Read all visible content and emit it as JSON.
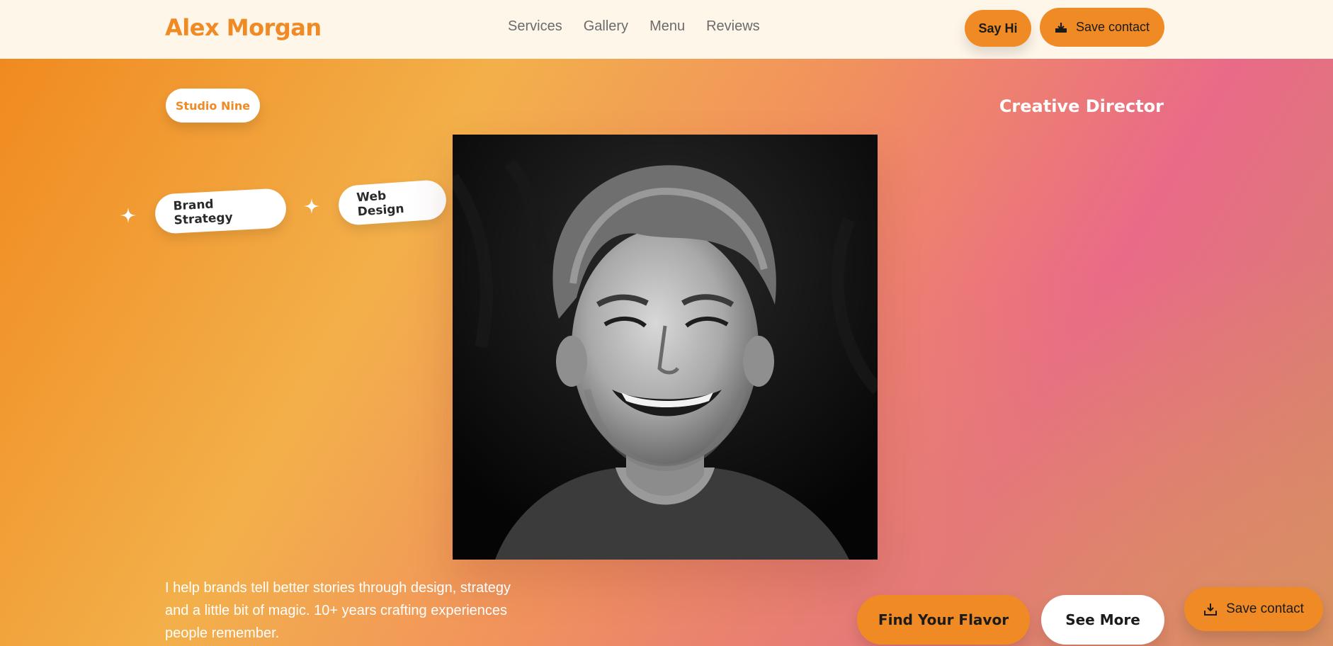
{
  "header": {
    "logo": "Alex Morgan",
    "nav": [
      {
        "label": "Services"
      },
      {
        "label": "Gallery"
      },
      {
        "label": "Menu"
      },
      {
        "label": "Reviews"
      }
    ],
    "say_hi": "Say Hi",
    "save_contact": "Save contact",
    "save_icon": "download-tray-icon"
  },
  "hero": {
    "badge": "Studio Nine",
    "role": "Creative Director",
    "chips": [
      "Brand Strategy",
      "Web Design"
    ],
    "sparkle_icon": "sparkle-icon",
    "photo_icon": "portrait-photo",
    "intro": "I help brands tell better stories through design, strategy and a little bit of magic. 10+ years crafting experiences people remember.",
    "primary_cta": "Find Your Flavor",
    "secondary_cta": "See More",
    "floating_save": "Save contact",
    "floating_save_icon": "download-icon"
  },
  "colors": {
    "accent": "#f08a24",
    "header_bg": "#fff6ea",
    "pink": "#e96a88",
    "text_dark": "#1b1b1b"
  }
}
